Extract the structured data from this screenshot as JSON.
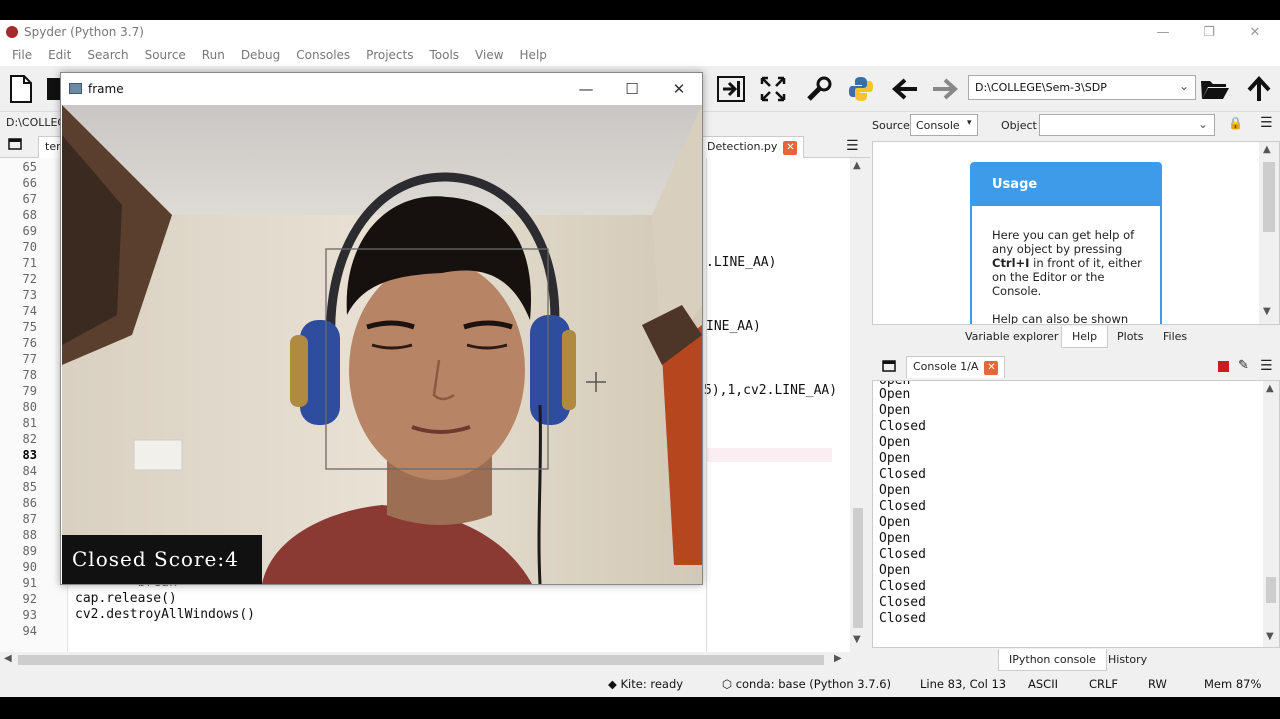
{
  "window": {
    "title": "Spyder (Python 3.7)",
    "controls": {
      "minimize": "—",
      "restore": "❐",
      "close": "✕"
    }
  },
  "menu": [
    "File",
    "Edit",
    "Search",
    "Source",
    "Run",
    "Debug",
    "Consoles",
    "Projects",
    "Tools",
    "View",
    "Help"
  ],
  "toolbar": {
    "working_dir": "D:\\COLLEGE\\Sem-3\\SDP"
  },
  "editor": {
    "path_prefix": "D:\\COLLEG",
    "tabs": {
      "first_partial": "ten",
      "current": "Detection.py"
    },
    "line_numbers": [
      "65",
      "66",
      "67",
      "68",
      "69",
      "70",
      "71",
      "72",
      "73",
      "74",
      "75",
      "76",
      "77",
      "78",
      "79",
      "80",
      "81",
      "82",
      "83",
      "84",
      "85",
      "86",
      "87",
      "88",
      "89",
      "90",
      "91",
      "92",
      "93",
      "94"
    ],
    "active_line": "83",
    "code_fragments": {
      "frag71": ".LINE_AA)",
      "frag75": "INE_AA)",
      "frag79": "5),1,cv2.LINE_AA)",
      "line91": "        break",
      "line92": "cap.release()",
      "line93": "cv2.destroyAllWindows()"
    }
  },
  "frame_window": {
    "title": "frame",
    "overlay_text": "Closed Score:4"
  },
  "help": {
    "source_label": "Source",
    "source_value": "Console",
    "object_label": "Object",
    "usage_title": "Usage",
    "usage_text_1": "Here you can get help of any object by pressing",
    "usage_shortcut": "Ctrl+I",
    "usage_text_2": "in front of it, either on the Editor or the Console.",
    "usage_text_3": "Help can also be shown",
    "tabs": [
      "Variable explorer",
      "Help",
      "Plots",
      "Files"
    ]
  },
  "console": {
    "tab": "Console 1/A",
    "lines": [
      "Open",
      "Open",
      "Open",
      "Closed",
      "Open",
      "Open",
      "Closed",
      "Open",
      "Closed",
      "Open",
      "Open",
      "Closed",
      "Open",
      "Closed",
      "Closed",
      "Closed"
    ],
    "bottom_tabs": [
      "IPython console",
      "History"
    ]
  },
  "status": {
    "kite": "Kite: ready",
    "conda": "conda: base (Python 3.7.6)",
    "position": "Line 83, Col 13",
    "encoding": "ASCII",
    "eol": "CRLF",
    "mode": "RW",
    "mem": "Mem 87%"
  },
  "colors": {
    "accent_blue": "#3d9be9",
    "close_tab": "#e8643a",
    "stop_red": "#c81e1e"
  }
}
